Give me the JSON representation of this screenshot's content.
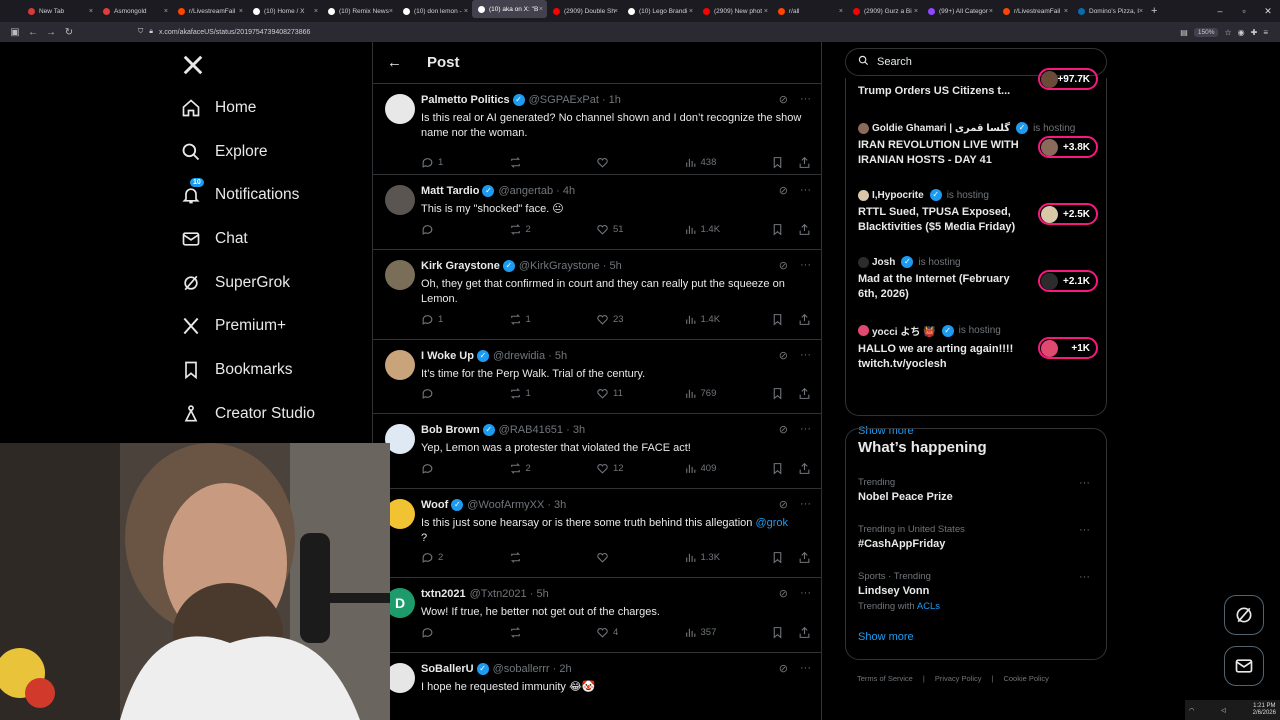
{
  "browser": {
    "tabs": [
      {
        "label": "New Tab",
        "color": "#d43b3b"
      },
      {
        "label": "Asmongold",
        "color": "#e23b3b"
      },
      {
        "label": "r/LivestreamFail",
        "color": "#ff4500"
      },
      {
        "label": "(10) Home / X",
        "color": "#ffffff"
      },
      {
        "label": "(10) Remix News",
        "color": "#ffffff"
      },
      {
        "label": "(10) don lemon -",
        "color": "#ffffff"
      },
      {
        "label": "(10) aka on X: \"B",
        "color": "#ffffff"
      },
      {
        "label": "(2909) Double Sh",
        "color": "#ff0000"
      },
      {
        "label": "(10) Lego Brandi",
        "color": "#ffffff"
      },
      {
        "label": "(2909) New phot",
        "color": "#ff0000"
      },
      {
        "label": "r/all",
        "color": "#ff4500"
      },
      {
        "label": "(2909) Gurz a Bi",
        "color": "#ff0000"
      },
      {
        "label": "(99+) All Categor",
        "color": "#9146ff"
      },
      {
        "label": "r/LivestreamFail",
        "color": "#ff4500"
      },
      {
        "label": "Domino's Pizza, I",
        "color": "#0b6aa8"
      }
    ],
    "url": "x.com/akafaceUS/status/2019754739408273866",
    "zoom": "150%"
  },
  "leftnav": {
    "items": [
      {
        "label": "Home",
        "icon": "home-icon"
      },
      {
        "label": "Explore",
        "icon": "search-icon"
      },
      {
        "label": "Notifications",
        "icon": "bell-icon",
        "badge": "10"
      },
      {
        "label": "Chat",
        "icon": "mail-icon"
      },
      {
        "label": "SuperGrok",
        "icon": "grok-icon"
      },
      {
        "label": "Premium+",
        "icon": "x-icon"
      },
      {
        "label": "Bookmarks",
        "icon": "bookmark-icon"
      },
      {
        "label": "Creator Studio",
        "icon": "creator-icon"
      }
    ]
  },
  "post": {
    "title": "Post",
    "replies": [
      {
        "name": "Palmetto Politics",
        "handle": "@SGPAExPat · 1h",
        "text": "Is this real or AI generated? No channel shown and I don’t recognize the show name nor the woman.",
        "replies": "1",
        "reposts": "",
        "likes": "",
        "views": "438",
        "avatar_color": "#e8e8e8"
      },
      {
        "name": "Matt Tardio",
        "handle": "@angertab · 4h",
        "text": "This is my \"shocked\" face. 😐",
        "replies": "",
        "reposts": "2",
        "likes": "51",
        "views": "1.4K",
        "avatar_color": "#5a5550"
      },
      {
        "name": "Kirk Graystone",
        "handle": "@KirkGraystone · 5h",
        "text": "Oh, they get that confirmed in court and they can really put the squeeze on Lemon.",
        "replies": "1",
        "reposts": "1",
        "likes": "23",
        "views": "1.4K",
        "avatar_color": "#7a6e58"
      },
      {
        "name": "I Woke Up",
        "handle": "@drewidia · 5h",
        "text": "It’s time for the Perp Walk.  Trial of the century.",
        "replies": "",
        "reposts": "1",
        "likes": "11",
        "views": "769",
        "avatar_color": "#c9a37a"
      },
      {
        "name": "Bob Brown",
        "handle": "@RAB41651 · 3h",
        "text": "Yep, Lemon was a protester that violated the FACE act!",
        "replies": "",
        "reposts": "2",
        "likes": "12",
        "views": "409",
        "avatar_color": "#dfe9f3"
      },
      {
        "name": "Woof",
        "handle": "@WoofArmyXX · 3h",
        "text": "Is this just sone hearsay or is there some truth behind this allegation",
        "mention": "@grok",
        "text_tail": "?",
        "replies": "2",
        "reposts": "",
        "likes": "",
        "views": "1.3K",
        "avatar_color": "#f1c232"
      },
      {
        "name": "txtn2021",
        "handle": "@Txtn2021 · 5h",
        "text": "Wow! If true, he better not get out of the charges.",
        "replies": "",
        "reposts": "",
        "likes": "4",
        "views": "357",
        "avatar_color": "#1e9b6a",
        "initial": "D"
      },
      {
        "name": "SoBallerU",
        "handle": "@soballerrr · 2h",
        "text": "I hope he requested immunity 😂🤡",
        "replies": "",
        "reposts": "",
        "likes": "",
        "views": "",
        "avatar_color": "#e6e6e6"
      }
    ]
  },
  "right": {
    "search_placeholder": "Search",
    "live": [
      {
        "host": "",
        "title": "Trump Orders US Citizens t...",
        "count": "+97.7K",
        "pill_color": "#6b4a3a"
      },
      {
        "host": "Goldie Ghamari | گلسا قمری",
        "hosting": "is hosting",
        "title": "IRAN REVOLUTION LIVE WITH IRANIAN HOSTS - DAY 41",
        "count": "+3.8K",
        "pill_color": "#8a6a5a"
      },
      {
        "host": "I,Hypocrite",
        "hosting": "is hosting",
        "title": "RTTL Sued, TPUSA Exposed, Blacktivities ($5 Media Friday)",
        "count": "+2.5K",
        "pill_color": "#d9c7a8"
      },
      {
        "host": "Josh",
        "hosting": "is hosting",
        "title": "Mad at the Internet (February 6th, 2026)",
        "count": "+2.1K",
        "pill_color": "#2c2c2c"
      },
      {
        "host": "yocci よち 👹",
        "hosting": "is hosting",
        "title": "HALLO we are arting again!!!! twitch.tv/yoclesh",
        "count": "+1K",
        "pill_color": "#e04a70"
      }
    ],
    "show_more": "Show more",
    "happening": {
      "title": "What’s happening",
      "trends": [
        {
          "context": "Trending",
          "name": "Nobel Peace Prize",
          "with": ""
        },
        {
          "context": "Trending in United States",
          "name": "#CashAppFriday",
          "with": ""
        },
        {
          "context": "Sports · Trending",
          "name": "Lindsey Vonn",
          "with_label": "Trending with",
          "with": "ACLs"
        }
      ],
      "show_more": "Show more"
    },
    "footer": [
      "Terms of Service",
      "Privacy Policy",
      "Cookie Policy"
    ]
  },
  "taskbar": {
    "time": "1:21 PM",
    "date": "2/6/2026"
  }
}
